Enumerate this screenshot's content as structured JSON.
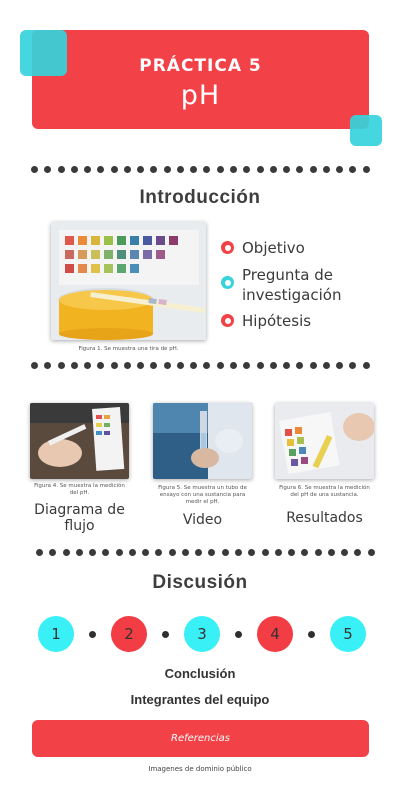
{
  "header": {
    "subtitle": "PRÁCTICA 5",
    "title": "pH"
  },
  "intro": {
    "heading": "Introducción",
    "figure_caption": "Figura 1. Se muestra una tira de pH.",
    "bullets": [
      {
        "label": "Objetivo",
        "color": "#f24147"
      },
      {
        "label": "Pregunta de investigación",
        "color": "#36d3dc"
      },
      {
        "label": "Hipótesis",
        "color": "#f24147"
      }
    ]
  },
  "gallery": [
    {
      "caption": "Figura 4. Se muestra la medición del pH.",
      "label": "Diagrama de flujo"
    },
    {
      "caption": "Figura 5. Se muestra un tubo de ensayo con una sustancia para medir el pH.",
      "label": "Video"
    },
    {
      "caption": "Figura 6. Se muestra la medición del pH de una sustancia.",
      "label": "Resultados"
    }
  ],
  "discussion": {
    "heading": "Discusión",
    "steps": [
      "1",
      "2",
      "3",
      "4",
      "5"
    ],
    "conclusion": "Conclusión",
    "team": "Integrantes del equipo"
  },
  "footer": {
    "references_button": "Referencias",
    "note": "Imagenes de dominio público"
  },
  "colors": {
    "accent_red": "#f24147",
    "accent_cyan": "#36d3dc",
    "bright_cyan": "#3af0f7",
    "text_dark": "#3a3a3a"
  }
}
